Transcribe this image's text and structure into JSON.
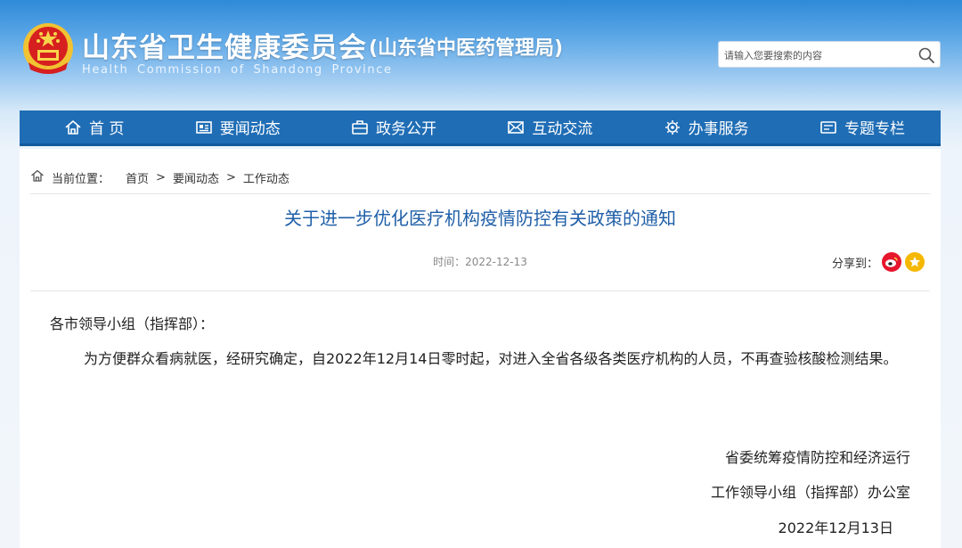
{
  "header": {
    "title": "山东省卫生健康委员会",
    "subtitle": "(山东省中医药管理局)",
    "english": "Health Commission of Shandong Province",
    "search_placeholder": "请输入您要搜索的内容"
  },
  "nav": {
    "items": [
      {
        "label": "首 页",
        "icon": "home-icon"
      },
      {
        "label": "要闻动态",
        "icon": "news-icon"
      },
      {
        "label": "政务公开",
        "icon": "briefcase-icon"
      },
      {
        "label": "互动交流",
        "icon": "interaction-icon"
      },
      {
        "label": "办事服务",
        "icon": "service-icon"
      },
      {
        "label": "专题专栏",
        "icon": "topic-icon"
      }
    ]
  },
  "breadcrumb": {
    "label": "当前位置：",
    "items": [
      "首页",
      "要闻动态",
      "工作动态"
    ],
    "separator": ">"
  },
  "article": {
    "title": "关于进一步优化医疗机构疫情防控有关政策的通知",
    "time": "时间：2022-12-13",
    "share_label": "分享到：",
    "salutation": "各市领导小组（指挥部）：",
    "body": "为方便群众看病就医，经研究确定，自2022年12月14日零时起，对进入全省各级各类医疗机构的人员，不再查验核酸检测结果。",
    "signature_line1": "省委统筹疫情防控和经济运行",
    "signature_line2": "工作领导小组（指挥部）办公室",
    "date": "2022年12月13日"
  },
  "colors": {
    "nav_bg": "#1f6db5",
    "title_color": "#1f5fa8",
    "weibo": "#e6162d",
    "favorite": "#f5b800"
  }
}
